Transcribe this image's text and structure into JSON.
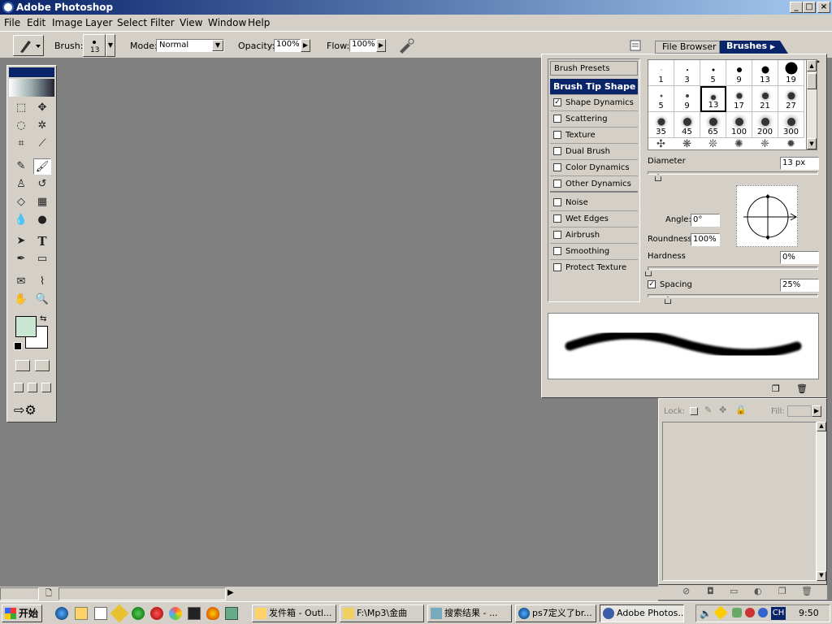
{
  "window": {
    "title": "Adobe Photoshop",
    "btn_min": "_",
    "btn_max": "□",
    "btn_close": "×"
  },
  "menu": [
    "File",
    "Edit",
    "Image",
    "Layer",
    "Select",
    "Filter",
    "View",
    "Window",
    "Help"
  ],
  "options": {
    "brush_label": "Brush:",
    "brush_size": "13",
    "mode_label": "Mode:",
    "mode_value": "Normal",
    "opacity_label": "Opacity:",
    "opacity_value": "100%",
    "flow_label": "Flow:",
    "flow_value": "100%"
  },
  "tabs": {
    "file_browser": "File Browser",
    "brushes": "Brushes"
  },
  "brush_panel": {
    "presets_label": "Brush Presets",
    "tip_shape": "Brush Tip Shape",
    "options": [
      {
        "label": "Shape Dynamics",
        "checked": "✓"
      },
      {
        "label": "Scattering",
        "checked": ""
      },
      {
        "label": "Texture",
        "checked": ""
      },
      {
        "label": "Dual Brush",
        "checked": ""
      },
      {
        "label": "Color Dynamics",
        "checked": ""
      },
      {
        "label": "Other Dynamics",
        "checked": ""
      },
      {
        "label": "Noise",
        "checked": ""
      },
      {
        "label": "Wet Edges",
        "checked": ""
      },
      {
        "label": "Airbrush",
        "checked": ""
      },
      {
        "label": "Smoothing",
        "checked": ""
      },
      {
        "label": "Protect Texture",
        "checked": ""
      }
    ],
    "brush_sizes": [
      "1",
      "3",
      "5",
      "9",
      "13",
      "19",
      "5",
      "9",
      "13",
      "17",
      "21",
      "27",
      "35",
      "45",
      "65",
      "100",
      "200",
      "300"
    ],
    "diameter_label": "Diameter",
    "diameter_value": "13 px",
    "angle_label": "Angle:",
    "angle_value": "0°",
    "roundness_label": "Roundness:",
    "roundness_value": "100%",
    "hardness_label": "Hardness",
    "hardness_value": "0%",
    "spacing_label": "Spacing",
    "spacing_checked": "✓",
    "spacing_value": "25%"
  },
  "layers": {
    "lock_label": "Lock:",
    "fill_label": "Fill:"
  },
  "taskbar": {
    "start": "开始",
    "items": [
      "发件箱 - Outl...",
      "F:\\Mp3\\金曲",
      "搜索结果 - ...",
      "ps7定义了br...",
      "Adobe Photos..."
    ],
    "clock": "9:50",
    "lang": "CH"
  },
  "colors": {
    "foreground": "#c8e6d2",
    "background": "#ffffff",
    "title_start": "#0a246a",
    "title_end": "#a6caf0"
  }
}
